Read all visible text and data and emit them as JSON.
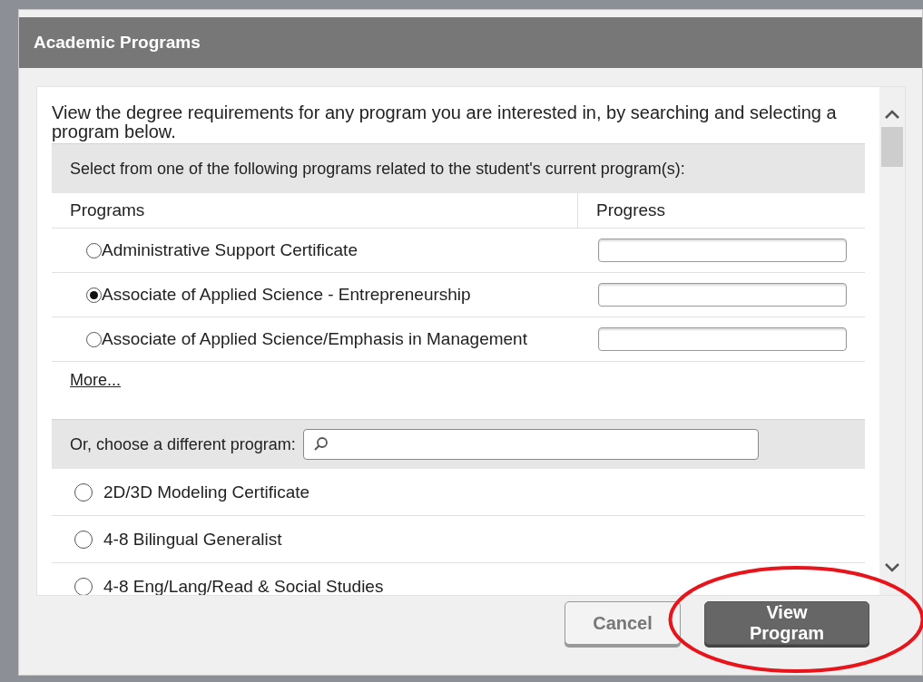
{
  "window": {
    "title": "Academic Programs"
  },
  "intro": "View the degree requirements for any program you are interested in, by searching and selecting a program below.",
  "related": {
    "heading": "Select from one of the following programs related to the student's current program(s):",
    "columns": [
      "Programs",
      "Progress"
    ],
    "rows": [
      {
        "name": "Administrative Support Certificate",
        "selected": false
      },
      {
        "name": "Associate of Applied Science - Entrepreneurship",
        "selected": true
      },
      {
        "name": "Associate of Applied Science/Emphasis in Management",
        "selected": false
      }
    ],
    "more_link": "More..."
  },
  "other": {
    "label": "Or, choose a different program:",
    "rows": [
      {
        "name": "2D/3D Modeling Certificate",
        "selected": false
      },
      {
        "name": "4-8 Bilingual Generalist",
        "selected": false
      },
      {
        "name": "4-8 Eng/Lang/Read & Social Studies",
        "selected": false
      }
    ]
  },
  "buttons": [
    {
      "label": "Cancel",
      "kind": "secondary"
    },
    {
      "label": "View Program",
      "kind": "primary"
    }
  ]
}
